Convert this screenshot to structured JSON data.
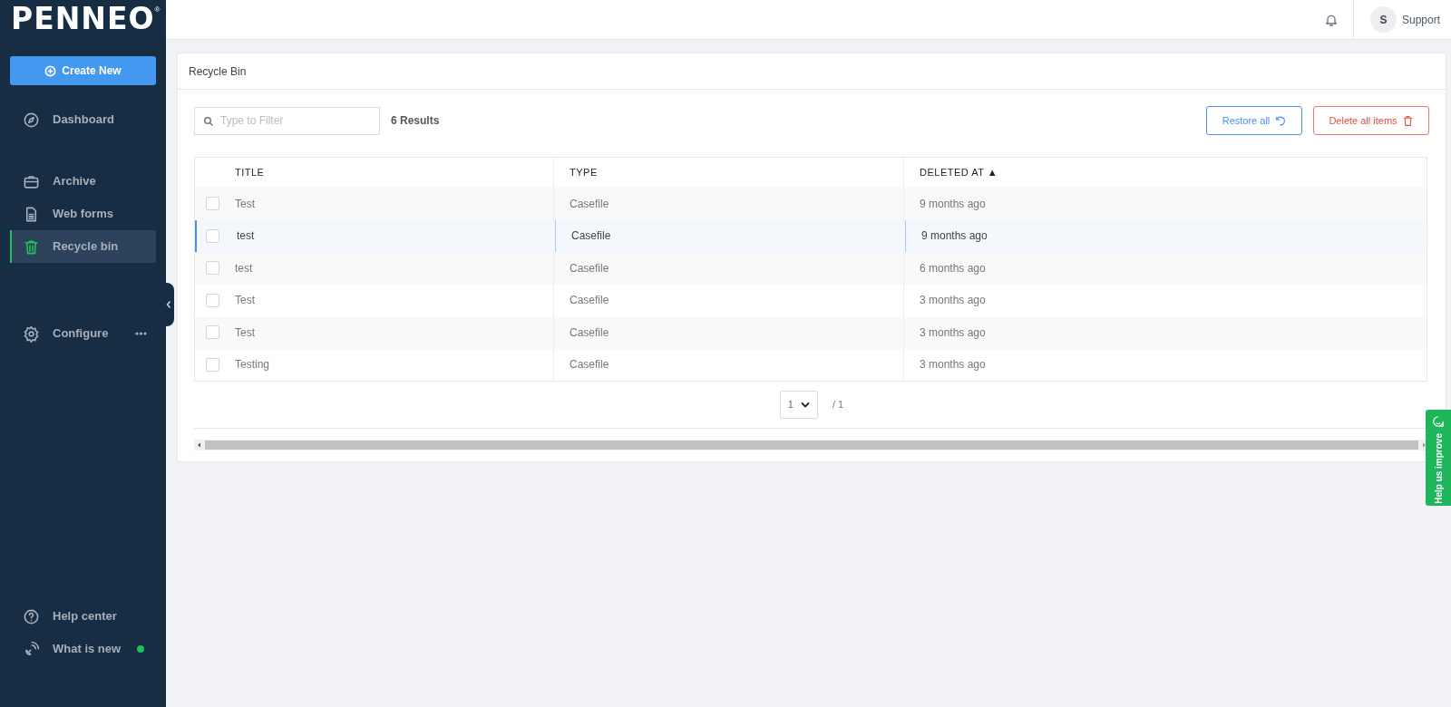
{
  "sidebar": {
    "logo": "PENNEO",
    "logo_mark": "®",
    "create_button": "Create New",
    "sections": [
      {
        "items": [
          {
            "label": "Dashboard",
            "selected": false
          }
        ]
      },
      {
        "items": [
          {
            "label": "Archive",
            "selected": false
          },
          {
            "label": "Web forms",
            "selected": false
          },
          {
            "label": "Recycle bin",
            "selected": true
          }
        ]
      },
      {
        "items": [
          {
            "label": "Configure",
            "selected": false,
            "more": true
          }
        ]
      },
      {
        "items": [
          {
            "label": "Help center",
            "selected": false
          },
          {
            "label": "What is new",
            "selected": false,
            "new_dot": true
          }
        ]
      }
    ]
  },
  "top_bar": {
    "user_initial": "S",
    "user_name": "Support"
  },
  "card": {
    "title": "Recycle Bin",
    "filter": {
      "placeholder": "Type to Filter"
    },
    "result_count": "6 Results",
    "restore_button": "Restore all",
    "delete_button": "Delete all items",
    "table": {
      "columns": [
        {
          "label": "TITLE"
        },
        {
          "label": "TYPE"
        },
        {
          "label": "DELETED AT ▲"
        }
      ],
      "rows": [
        {
          "title": "Test",
          "type": "Casefile",
          "deleted_at": "9 months ago",
          "checked": false,
          "highlighted": false
        },
        {
          "title": "test",
          "type": "Casefile",
          "deleted_at": "9 months ago",
          "checked": false,
          "highlighted": true
        },
        {
          "title": "test",
          "type": "Casefile",
          "deleted_at": "6 months ago",
          "checked": false,
          "highlighted": false
        },
        {
          "title": "Test",
          "type": "Casefile",
          "deleted_at": "3 months ago",
          "checked": false,
          "highlighted": false
        },
        {
          "title": "Test",
          "type": "Casefile",
          "deleted_at": "3 months ago",
          "checked": false,
          "highlighted": false
        },
        {
          "title": "Testing",
          "type": "Casefile",
          "deleted_at": "3 months ago",
          "checked": false,
          "highlighted": false
        }
      ]
    },
    "pagination": {
      "page": "1",
      "total": "/ 1"
    }
  },
  "feedback_tab": "Help us improve"
}
